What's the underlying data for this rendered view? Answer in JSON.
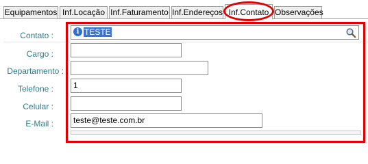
{
  "tabs": [
    {
      "label": "Equipamentos"
    },
    {
      "label": "Inf.Locação"
    },
    {
      "label": "Inf.Faturamento"
    },
    {
      "label": "Inf.Endereços"
    },
    {
      "label": "Inf.Contato"
    },
    {
      "label": "Observações"
    }
  ],
  "active_tab": "Inf.Contato",
  "form": {
    "contato": {
      "label": "Contato :",
      "value": "TESTE"
    },
    "cargo": {
      "label": "Cargo :",
      "value": ""
    },
    "departamento": {
      "label": "Departamento :",
      "value": ""
    },
    "telefone": {
      "label": "Telefone :",
      "value": "1"
    },
    "celular": {
      "label": "Celular :",
      "value": ""
    },
    "email": {
      "label": "E-Mail :",
      "value": "teste@teste.com.br"
    }
  },
  "colors": {
    "label_text": "#2f7a8c",
    "annotation": "#e00000",
    "selection": "#3a74d6"
  },
  "icons": {
    "contato_info": "info-icon",
    "contato_lookup": "search-icon"
  }
}
